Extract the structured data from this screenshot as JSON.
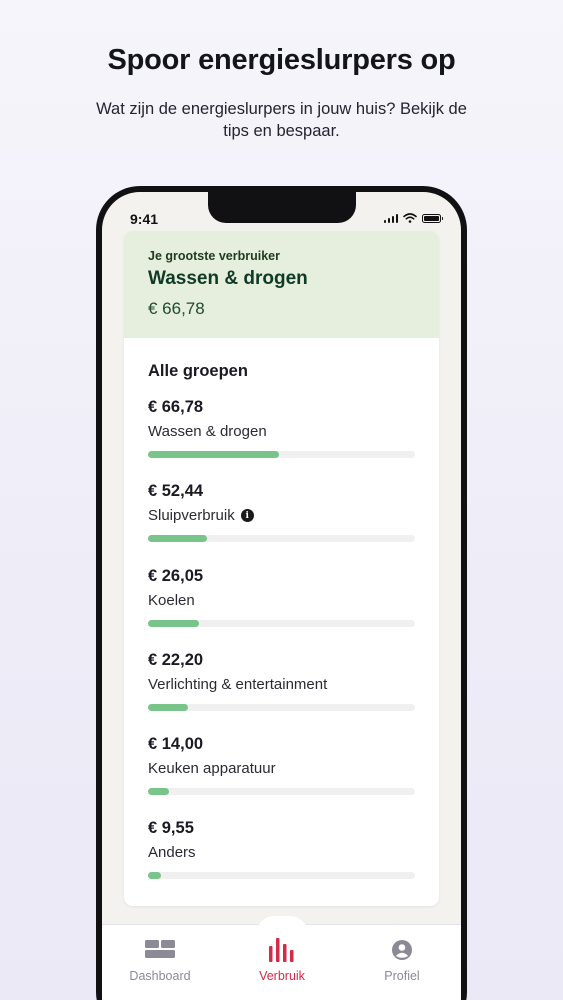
{
  "header": {
    "title": "Spoor energieslurpers op",
    "subtitle": "Wat zijn de energieslurpers in jouw huis? Bekijk de tips en bespaar."
  },
  "status_bar": {
    "time": "9:41"
  },
  "highlight": {
    "label": "Je grootste verbruiker",
    "title": "Wassen & drogen",
    "amount": "€ 66,78"
  },
  "groups": {
    "title": "Alle groepen",
    "items": [
      {
        "amount": "€ 66,78",
        "name": "Wassen & drogen",
        "share": 0.49,
        "info": false
      },
      {
        "amount": "€ 52,44",
        "name": "Sluipverbruik",
        "share": 0.22,
        "info": true
      },
      {
        "amount": "€ 26,05",
        "name": "Koelen",
        "share": 0.19,
        "info": false
      },
      {
        "amount": "€ 22,20",
        "name": "Verlichting & entertainment",
        "share": 0.15,
        "info": false
      },
      {
        "amount": "€ 14,00",
        "name": "Keuken apparatuur",
        "share": 0.08,
        "info": false
      },
      {
        "amount": "€ 9,55",
        "name": "Anders",
        "share": 0.05,
        "info": false
      }
    ]
  },
  "tabbar": {
    "tabs": [
      {
        "label": "Dashboard",
        "icon": "dashboard-icon",
        "active": false
      },
      {
        "label": "Verbruik",
        "icon": "bar-chart-icon",
        "active": true
      },
      {
        "label": "Profiel",
        "icon": "user-icon",
        "active": false
      }
    ]
  },
  "colors": {
    "accent": "#d62a47",
    "bar_fill": "#79c48b",
    "highlight_bg": "#e6eedd"
  }
}
